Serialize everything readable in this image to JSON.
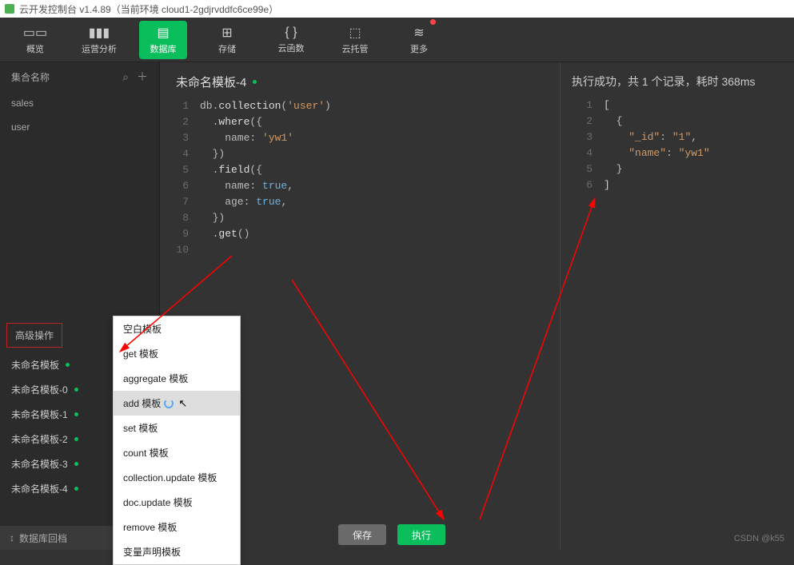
{
  "titlebar": {
    "text": "云开发控制台 v1.4.89（当前环境 cloud1-2gdjrvddfc6ce99e）"
  },
  "toolbar": {
    "items": [
      {
        "icon": "▭▭",
        "label": "概览"
      },
      {
        "icon": "▮▮▮",
        "label": "运营分析"
      },
      {
        "icon": "▤",
        "label": "数据库",
        "active": true
      },
      {
        "icon": "⊞",
        "label": "存储"
      },
      {
        "icon": "{ }",
        "label": "云函数"
      },
      {
        "icon": "⬚",
        "label": "云托管"
      },
      {
        "icon": "≋",
        "label": "更多",
        "notification": true
      }
    ]
  },
  "sidebar": {
    "header": "集合名称",
    "search_icon": "⌕",
    "add_icon": "＋",
    "collections": [
      "sales",
      "user"
    ],
    "adv_header": "高级操作",
    "templates": [
      {
        "label": "未命名模板",
        "modified": true
      },
      {
        "label": "未命名模板-0",
        "modified": true
      },
      {
        "label": "未命名模板-1",
        "modified": true
      },
      {
        "label": "未命名模板-2",
        "modified": true
      },
      {
        "label": "未命名模板-3",
        "modified": true
      },
      {
        "label": "未命名模板-4",
        "modified": true
      }
    ],
    "rollback_icon": "↕",
    "rollback_label": "数据库回档"
  },
  "editor": {
    "title": "未命名模板-4",
    "modified": true,
    "code_lines": [
      {
        "n": "1",
        "html": "db.<span class='t-fn'>collection</span>(<span class='t-str'>'user'</span>)"
      },
      {
        "n": "2",
        "html": "  .<span class='t-fn'>where</span>({"
      },
      {
        "n": "3",
        "html": "    name: <span class='t-str'>'yw1'</span>"
      },
      {
        "n": "4",
        "html": "  })"
      },
      {
        "n": "5",
        "html": "  .<span class='t-fn'>field</span>({"
      },
      {
        "n": "6",
        "html": "    name: <span class='t-kw'>true</span>,"
      },
      {
        "n": "7",
        "html": "    age: <span class='t-kw'>true</span>,"
      },
      {
        "n": "8",
        "html": "  })"
      },
      {
        "n": "9",
        "html": "  .<span class='t-fn'>get</span>()"
      },
      {
        "n": "10",
        "html": ""
      }
    ]
  },
  "result": {
    "title": "执行成功，共 1 个记录，耗时 368ms",
    "code_lines": [
      {
        "n": "1",
        "html": "<span class='t-pun'>[</span>"
      },
      {
        "n": "2",
        "html": "  {"
      },
      {
        "n": "3",
        "html": "    <span class='t-str'>\"_id\"</span>: <span class='t-str'>\"1\"</span>,"
      },
      {
        "n": "4",
        "html": "    <span class='t-str'>\"name\"</span>: <span class='t-str'>\"yw1\"</span>"
      },
      {
        "n": "5",
        "html": "  }"
      },
      {
        "n": "6",
        "html": "<span class='t-pun'>]</span>"
      }
    ]
  },
  "context_menu": {
    "items": [
      {
        "label": "空白模板"
      },
      {
        "label": "get 模板"
      },
      {
        "label": "aggregate 模板"
      },
      {
        "label": "add 模板",
        "hover": true,
        "loading": true
      },
      {
        "label": "set 模板"
      },
      {
        "label": "count 模板"
      },
      {
        "label": "collection.update 模板"
      },
      {
        "label": "doc.update 模板"
      },
      {
        "label": "remove 模板"
      },
      {
        "label": "变量声明模板"
      }
    ]
  },
  "footer": {
    "save": "保存",
    "run": "执行"
  },
  "watermark": "CSDN @k55"
}
